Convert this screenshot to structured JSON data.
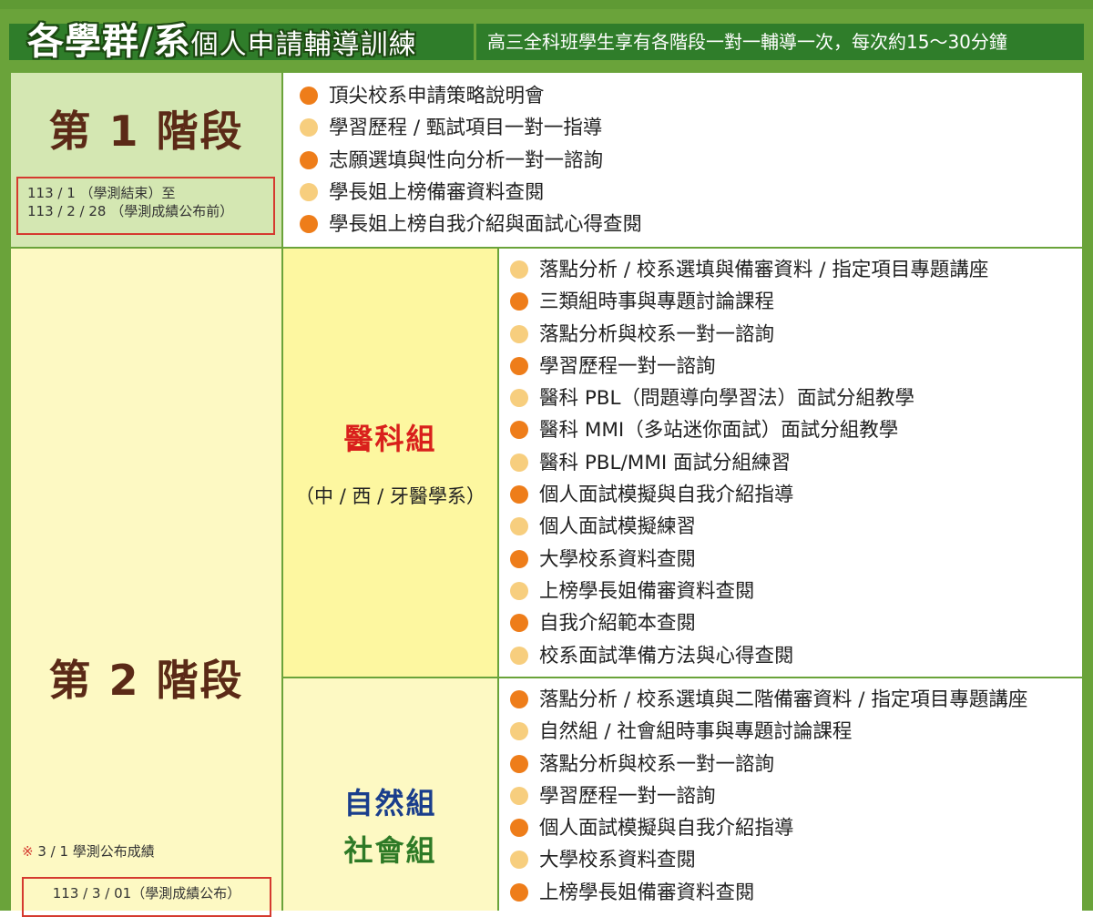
{
  "header": {
    "title": "各學群/系",
    "title_suffix": "個人申請輔導訓練",
    "note": "高三全科班學生享有各階段一對一輔導一次，每次約15～30分鐘"
  },
  "stage1": {
    "title": "第 1 階段",
    "date_line1": "113 / 1 （學測結束）至",
    "date_line2": "113 / 2 / 28 （學測成績公布前）",
    "items": [
      {
        "text": "頂尖校系申請策略說明會",
        "bullet": "dark"
      },
      {
        "text": "學習歷程 /  甄試項目一對一指導",
        "bullet": "light"
      },
      {
        "text": "志願選填與性向分析一對一諮詢",
        "bullet": "dark"
      },
      {
        "text": "學長姐上榜備審資料查閱",
        "bullet": "light"
      },
      {
        "text": "學長姐上榜自我介紹與面試心得查閱",
        "bullet": "dark"
      }
    ]
  },
  "stage2": {
    "title": "第 2 階段",
    "note": "3 / 1 學測公布成績",
    "note_mark": "※",
    "date": "113 / 3 / 01（學測成績公布）",
    "medical": {
      "name": "醫科組",
      "sub": "（中 / 西 / 牙醫學系）",
      "color": "#d9201c",
      "items": [
        {
          "text": "落點分析 / 校系選填與備審資料 / 指定項目專題講座",
          "bullet": "light"
        },
        {
          "text": "三類組時事與專題討論課程",
          "bullet": "dark"
        },
        {
          "text": "落點分析與校系一對一諮詢",
          "bullet": "light"
        },
        {
          "text": "學習歷程一對一諮詢",
          "bullet": "dark"
        },
        {
          "text": "醫科 PBL（問題導向學習法）面試分組教學",
          "bullet": "light"
        },
        {
          "text": "醫科 MMI（多站迷你面試）面試分組教學",
          "bullet": "dark"
        },
        {
          "text": "醫科 PBL/MMI 面試分組練習",
          "bullet": "light"
        },
        {
          "text": "個人面試模擬與自我介紹指導",
          "bullet": "dark"
        },
        {
          "text": "個人面試模擬練習",
          "bullet": "light"
        },
        {
          "text": "大學校系資料查閱",
          "bullet": "dark"
        },
        {
          "text": "上榜學長姐備審資料查閱",
          "bullet": "light"
        },
        {
          "text": "自我介紹範本查閱",
          "bullet": "dark"
        },
        {
          "text": "校系面試準備方法與心得查閱",
          "bullet": "light"
        }
      ]
    },
    "general": {
      "name1": "自然組",
      "name2": "社會組",
      "color1": "#1a3e8c",
      "color2": "#2e7a26",
      "items": [
        {
          "text": "落點分析 / 校系選填與二階備審資料 / 指定項目專題講座",
          "bullet": "dark"
        },
        {
          "text": "自然組 / 社會組時事與專題討論課程",
          "bullet": "light"
        },
        {
          "text": "落點分析與校系一對一諮詢",
          "bullet": "dark"
        },
        {
          "text": "學習歷程一對一諮詢",
          "bullet": "light"
        },
        {
          "text": "個人面試模擬與自我介紹指導",
          "bullet": "dark"
        },
        {
          "text": "大學校系資料查閱",
          "bullet": "light"
        },
        {
          "text": "上榜學長姐備審資料查閱",
          "bullet": "dark"
        }
      ]
    }
  }
}
